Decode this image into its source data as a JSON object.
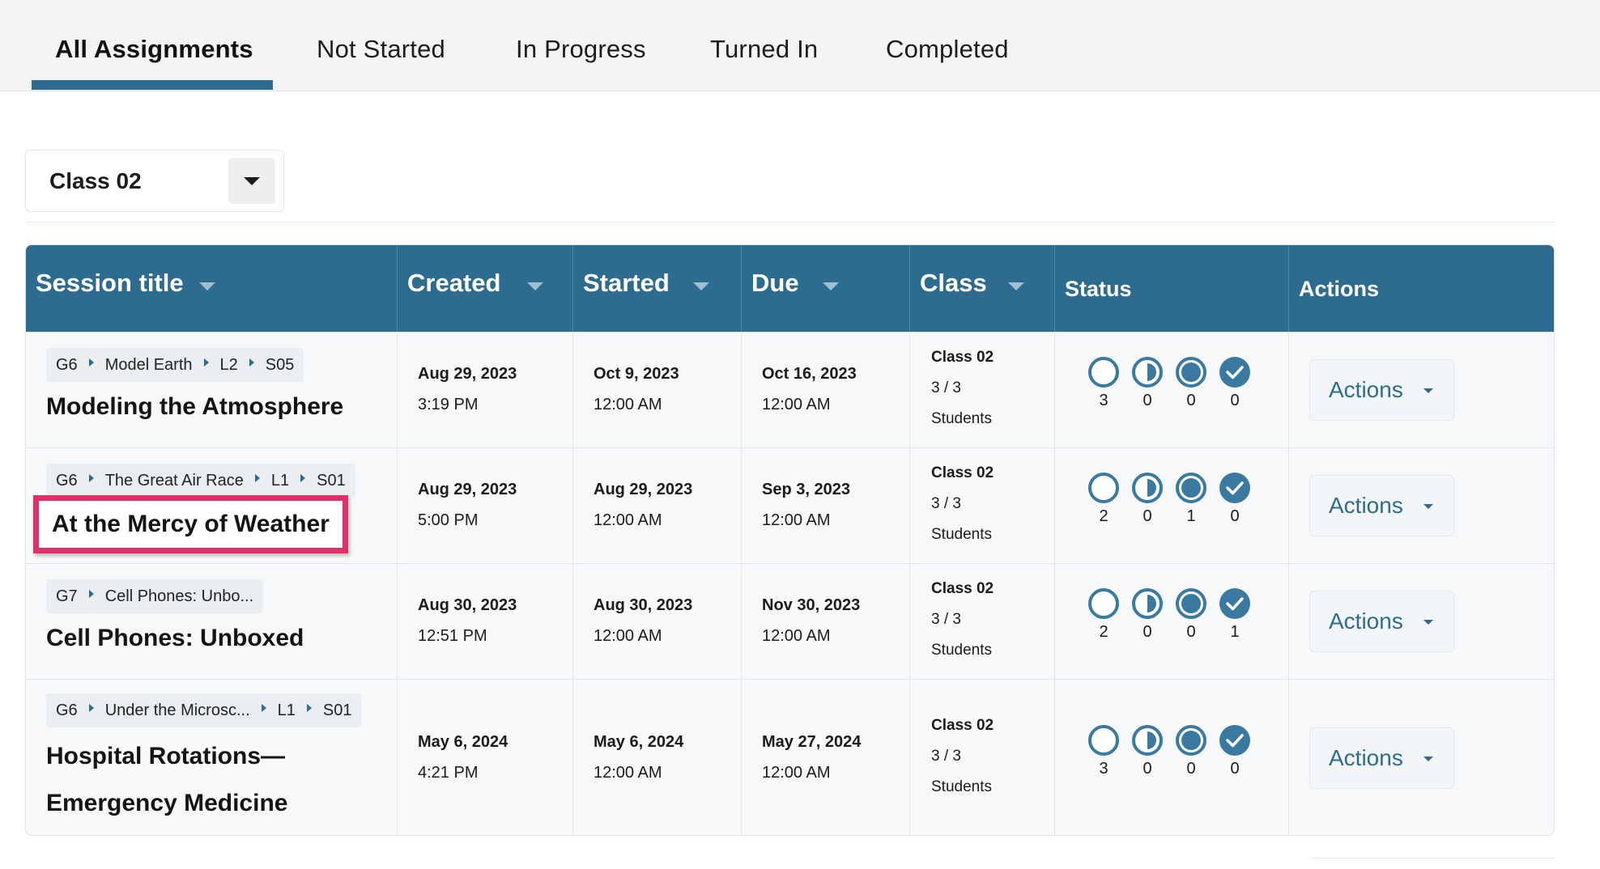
{
  "tabs": {
    "all": "All Assignments",
    "not_started": "Not Started",
    "in_progress": "In Progress",
    "turned_in": "Turned In",
    "completed": "Completed"
  },
  "filter": {
    "class_selected": "Class 02"
  },
  "colors": {
    "primary": "#2e6c8f",
    "highlight": "#e0306c"
  },
  "table": {
    "headers": {
      "session_title": "Session title",
      "created": "Created",
      "started": "Started",
      "due": "Due",
      "class": "Class",
      "status": "Status",
      "actions": "Actions"
    },
    "rows": [
      {
        "crumbs": [
          "G6",
          "Model Earth",
          "L2",
          "S05"
        ],
        "title": "Modeling the Atmosphere",
        "created_date": "Aug 29, 2023",
        "created_time": "3:19 PM",
        "started_date": "Oct 9, 2023",
        "started_time": "12:00 AM",
        "due_date": "Oct 16, 2023",
        "due_time": "12:00 AM",
        "class_name": "Class 02",
        "class_count": "3 / 3",
        "class_students": "Students",
        "status": {
          "not_started": "3",
          "in_progress": "0",
          "turned_in": "0",
          "completed": "0"
        },
        "actions_label": "Actions"
      },
      {
        "crumbs": [
          "G6",
          "The Great Air Race",
          "L1",
          "S01"
        ],
        "title": "At the Mercy of Weather",
        "created_date": "Aug 29, 2023",
        "created_time": "5:00 PM",
        "started_date": "Aug 29, 2023",
        "started_time": "12:00 AM",
        "due_date": "Sep 3, 2023",
        "due_time": "12:00 AM",
        "class_name": "Class 02",
        "class_count": "3 / 3",
        "class_students": "Students",
        "status": {
          "not_started": "2",
          "in_progress": "0",
          "turned_in": "1",
          "completed": "0"
        },
        "actions_label": "Actions"
      },
      {
        "crumbs": [
          "G7",
          "Cell Phones: Unbo..."
        ],
        "title": "Cell Phones: Unboxed",
        "created_date": "Aug 30, 2023",
        "created_time": "12:51 PM",
        "started_date": "Aug 30, 2023",
        "started_time": "12:00 AM",
        "due_date": "Nov 30, 2023",
        "due_time": "12:00 AM",
        "class_name": "Class 02",
        "class_count": "3 / 3",
        "class_students": "Students",
        "status": {
          "not_started": "2",
          "in_progress": "0",
          "turned_in": "0",
          "completed": "1"
        },
        "actions_label": "Actions"
      },
      {
        "crumbs": [
          "G6",
          "Under the Microsc...",
          "L1",
          "S01"
        ],
        "title_line1": "Hospital Rotations—",
        "title_line2": "Emergency Medicine",
        "created_date": "May 6, 2024",
        "created_time": "4:21 PM",
        "started_date": "May 6, 2024",
        "started_time": "12:00 AM",
        "due_date": "May 27, 2024",
        "due_time": "12:00 AM",
        "class_name": "Class 02",
        "class_count": "3 / 3",
        "class_students": "Students",
        "status": {
          "not_started": "3",
          "in_progress": "0",
          "turned_in": "0",
          "completed": "0"
        },
        "actions_label": "Actions"
      }
    ]
  }
}
